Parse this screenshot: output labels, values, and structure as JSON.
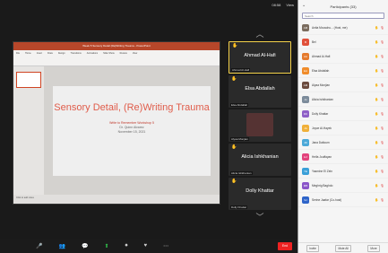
{
  "window": {
    "status_time": "08:58",
    "status_view": "View"
  },
  "ppt": {
    "window_title": "Week 5 Sensory Detail (Re)Writing Trauma - PowerPoint",
    "ribbon": [
      "File",
      "Home",
      "Insert",
      "Draw",
      "Design",
      "Transitions",
      "Animations",
      "Slide Show",
      "Review",
      "View"
    ],
    "slide_title": "Sensory Detail, (Re)Writing Trauma",
    "slide_sub1": "Write to Remember Workshop 5",
    "slide_sub2": "Dr. Quinn Alvarez",
    "slide_sub3": "November 15, 2021",
    "notes": "Click to add notes"
  },
  "video_strip": {
    "tiles": [
      {
        "name": "Ahmad Al-Hafi",
        "label": "Ahmad Al-Hafi",
        "active": true
      },
      {
        "name": "Elsa Abdallah",
        "label": "Elsa Abdallah",
        "active": false
      },
      {
        "name": "",
        "label": "Alyaa Monjian",
        "active": false
      },
      {
        "name": "Alicia Ishkhanian",
        "label": "Alicia Ishkhanian",
        "active": false
      },
      {
        "name": "Dolly Khattar",
        "label": "Dolly Khattar",
        "active": false
      }
    ]
  },
  "toolbar": {
    "end": "End"
  },
  "participants": {
    "header": "Participants (33)",
    "search_placeholder": "Search",
    "list": [
      {
        "name": "Anita Mouschu... (Host, me)",
        "initials": "AM",
        "color": "#7a6c5e"
      },
      {
        "name": "Bel",
        "initials": "B",
        "color": "#e0503a"
      },
      {
        "name": "Ahmad Al-Hafi",
        "initials": "AA",
        "color": "#e57a2d"
      },
      {
        "name": "Elsa Abdallah",
        "initials": "EA",
        "color": "#f08c2a"
      },
      {
        "name": "Alyaa Monjian",
        "initials": "AM",
        "color": "#6b4b3e"
      },
      {
        "name": "Alicia Ishkhanian",
        "initials": "AI",
        "color": "#7c8b9a"
      },
      {
        "name": "Dolly Khattar",
        "initials": "DK",
        "color": "#8e5fc7"
      },
      {
        "name": "Joyce Al-Hayek",
        "initials": "JA",
        "color": "#f0b03a"
      },
      {
        "name": "Jana Daltoum",
        "initials": "JD",
        "color": "#4ba8d8"
      },
      {
        "name": "Heifa Jouffayan",
        "initials": "HJ",
        "color": "#e2427c"
      },
      {
        "name": "Yasmine El Zein",
        "initials": "YE",
        "color": "#3a9fd8"
      },
      {
        "name": "Meghrig Baghdo",
        "initials": "MB",
        "color": "#8a55c9"
      },
      {
        "name": "Serine Jaafar (Co-host)",
        "initials": "SJ",
        "color": "#2e64c9"
      }
    ],
    "footer_invite": "Invite",
    "footer_mute": "Mute All",
    "footer_more": "More"
  }
}
